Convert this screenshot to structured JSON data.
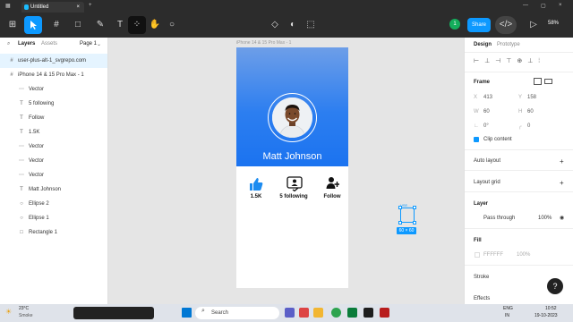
{
  "titlebar": {
    "tab_label": "Untitled",
    "close": "×",
    "add": "+"
  },
  "toolbar": {
    "share_label": "Share",
    "zoom": "58%",
    "user_initial": "1"
  },
  "layers_panel": {
    "tab_layers": "Layers",
    "tab_assets": "Assets",
    "page_label": "Page 1",
    "items": [
      {
        "label": "user-plus-alt-1_svgrepo.com",
        "icon": "#",
        "selected": true,
        "child": false
      },
      {
        "label": "iPhone 14 & 15 Pro Max - 1",
        "icon": "#",
        "selected": false,
        "child": false
      },
      {
        "label": "Vector",
        "icon": "⋯",
        "child": true
      },
      {
        "label": "5 following",
        "icon": "T",
        "child": true
      },
      {
        "label": "Follow",
        "icon": "T",
        "child": true
      },
      {
        "label": "1.5K",
        "icon": "T",
        "child": true
      },
      {
        "label": "Vector",
        "icon": "⋯",
        "child": true
      },
      {
        "label": "Vector",
        "icon": "⋯",
        "child": true
      },
      {
        "label": "Vector",
        "icon": "⋯",
        "child": true
      },
      {
        "label": "Matt Johnson",
        "icon": "T",
        "child": true
      },
      {
        "label": "Ellipse 2",
        "icon": "○",
        "child": true
      },
      {
        "label": "Ellipse 1",
        "icon": "○",
        "child": true
      },
      {
        "label": "Rectangle 1",
        "icon": "□",
        "child": true
      }
    ]
  },
  "canvas": {
    "frame_label": "iPhone 14 & 15 Pro Max - 1",
    "profile_name": "Matt Johnson",
    "stats": [
      {
        "value": "1.5K"
      },
      {
        "value": "5 following"
      },
      {
        "value": "Follow"
      }
    ],
    "selection_label": "USE...",
    "selection_size": "60 × 60"
  },
  "right_panel": {
    "tab_design": "Design",
    "tab_prototype": "Prototype",
    "frame_label": "Frame",
    "x_label": "X",
    "x_value": "413",
    "y_label": "Y",
    "y_value": "158",
    "w_label": "W",
    "w_value": "60",
    "h_label": "H",
    "h_value": "60",
    "rotation": "0°",
    "radius": "0",
    "clip_content": "Clip content",
    "auto_layout": "Auto layout",
    "layout_grid": "Layout grid",
    "layer_label": "Layer",
    "blend_mode": "Pass through",
    "layer_opacity": "100%",
    "fill_label": "Fill",
    "fill_hex": "FFFFFF",
    "fill_opacity": "100%",
    "stroke_label": "Stroke",
    "effects_label": "Effects",
    "help": "?"
  },
  "taskbar": {
    "weather_temp": "23°C",
    "weather_desc": "Smoke",
    "search_placeholder": "Search",
    "lang1": "ENG",
    "lang2": "IN",
    "time": "10:52",
    "date": "19-10-2023"
  },
  "colors": {
    "accent": "#0d99ff",
    "header_top": "#6d9ee8",
    "header_bottom": "#1b73f0",
    "toolbar": "#2c2c2c"
  }
}
